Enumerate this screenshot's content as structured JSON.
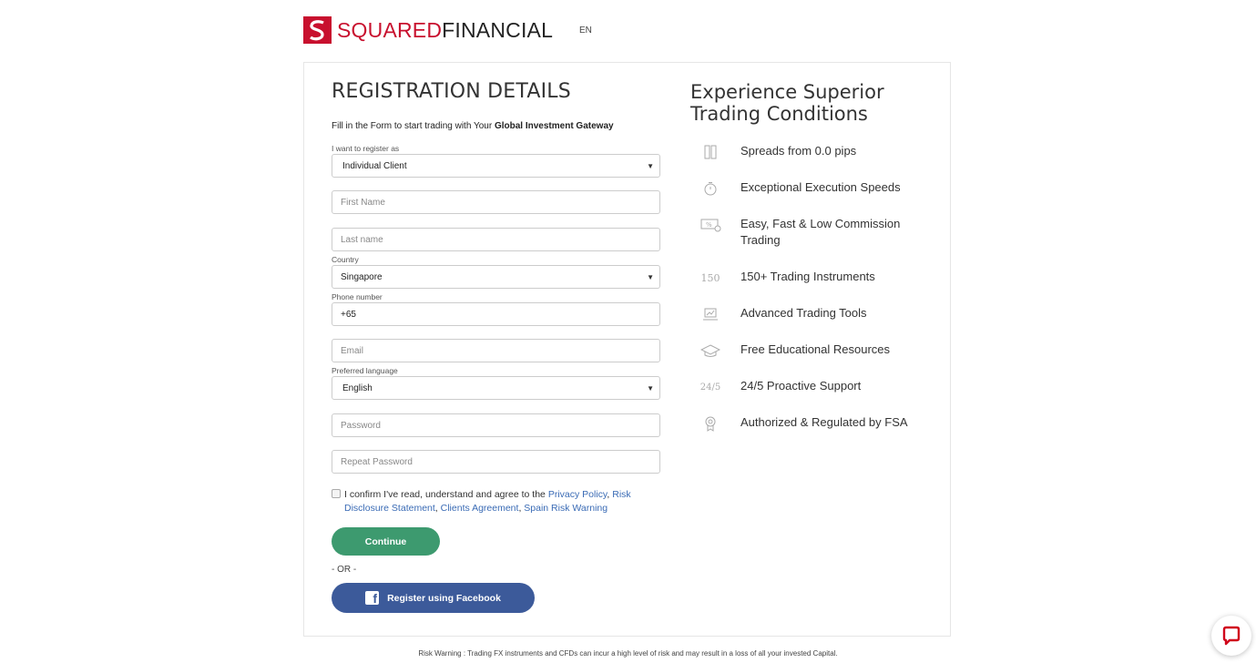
{
  "header": {
    "logo_part1": "SQUARED",
    "logo_part2": "FINANCIAL",
    "language": "EN"
  },
  "form": {
    "title": "REGISTRATION DETAILS",
    "intro_prefix": "Fill in the Form to start trading with Your ",
    "intro_bold": "Global Investment Gateway",
    "register_as_label": "I want to register as",
    "register_as_value": "Individual Client",
    "first_name_placeholder": "First Name",
    "last_name_placeholder": "Last name",
    "country_label": "Country",
    "country_value": "Singapore",
    "phone_label": "Phone number",
    "phone_value": "+65",
    "email_placeholder": "Email",
    "language_label": "Preferred language",
    "language_value": "English",
    "password_placeholder": "Password",
    "repeat_password_placeholder": "Repeat Password",
    "confirm_prefix": "I confirm I've read, understand and agree to the ",
    "link_privacy": "Privacy Policy",
    "link_risk": "Risk Disclosure Statement",
    "link_clients": "Clients Agreement",
    "link_spain": "Spain Risk Warning",
    "sep": ", ",
    "continue_label": "Continue",
    "or_text": "- OR -",
    "facebook_label": "Register using Facebook"
  },
  "benefits": {
    "title": "Experience Superior Trading Conditions",
    "items": [
      {
        "icon": "spreads-icon",
        "text": "Spreads from 0.0 pips"
      },
      {
        "icon": "stopwatch-icon",
        "text": "Exceptional Execution Speeds"
      },
      {
        "icon": "commission-icon",
        "text": "Easy, Fast & Low Commission Trading"
      },
      {
        "icon": "instruments-icon",
        "text": "150+ Trading Instruments",
        "glyph": "150"
      },
      {
        "icon": "tools-icon",
        "text": "Advanced Trading Tools"
      },
      {
        "icon": "education-icon",
        "text": "Free Educational Resources"
      },
      {
        "icon": "support-icon",
        "text": "24/5 Proactive Support",
        "glyph": "24/5"
      },
      {
        "icon": "regulated-icon",
        "text": "Authorized & Regulated by FSA"
      }
    ]
  },
  "footer": {
    "risk_warning": "Risk Warning : Trading FX instruments and CFDs can incur a high level of risk and may result in a loss of all your invested Capital."
  },
  "colors": {
    "brand_red": "#c8102e",
    "continue_green": "#3d9a6f",
    "facebook_blue": "#3c5a9a",
    "link_blue": "#3a6bb5",
    "chat_red": "#d0021b"
  }
}
